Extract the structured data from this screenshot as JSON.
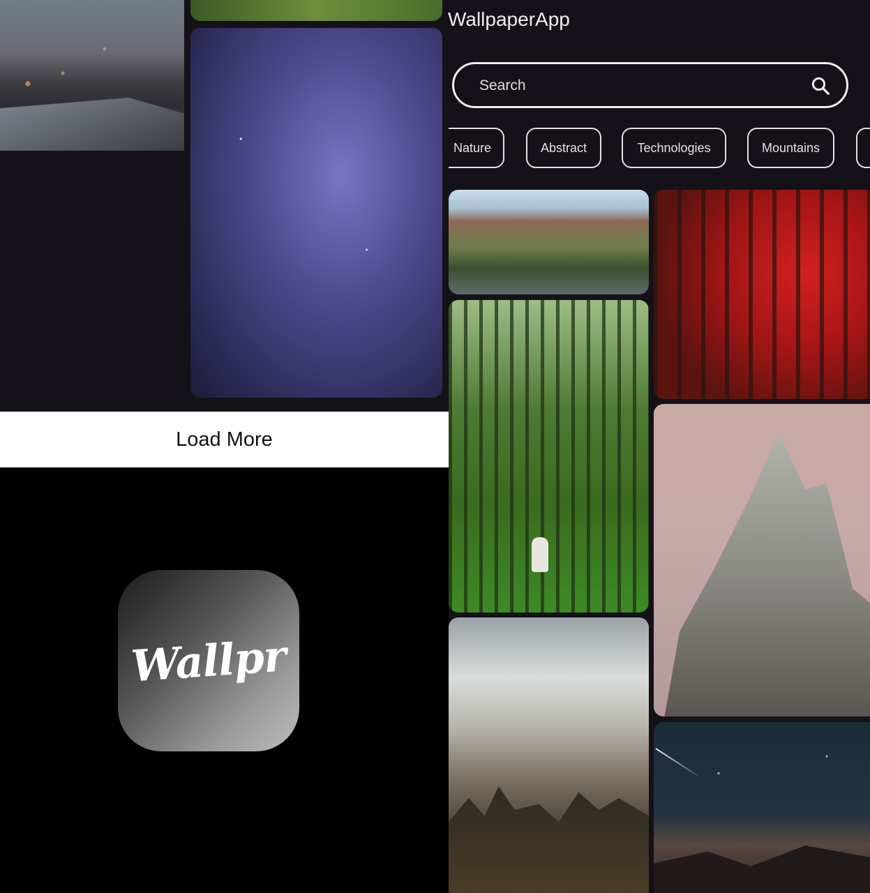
{
  "app": {
    "title": "WallpaperApp"
  },
  "search": {
    "placeholder": "Search",
    "value": ""
  },
  "categories": [
    "Nature",
    "Abstract",
    "Technologies",
    "Mountains"
  ],
  "load_more": {
    "label": "Load More"
  },
  "splash": {
    "logo_text": "Wallpr"
  },
  "wallpapers_left": [
    {
      "subject": "village-at-dusk"
    },
    {
      "subject": "green-blur"
    },
    {
      "subject": "starry-sky"
    }
  ],
  "wallpapers_right": [
    {
      "subject": "canyon-river"
    },
    {
      "subject": "red-forest"
    },
    {
      "subject": "green-forest-hiker"
    },
    {
      "subject": "mountain-peak"
    },
    {
      "subject": "valley-clouds"
    },
    {
      "subject": "night-sky-meteor"
    }
  ],
  "colors": {
    "background": "#141218",
    "chip_border": "#e6e1e5",
    "button_bg": "#ffffff"
  },
  "icons": {
    "search": "search-icon"
  }
}
